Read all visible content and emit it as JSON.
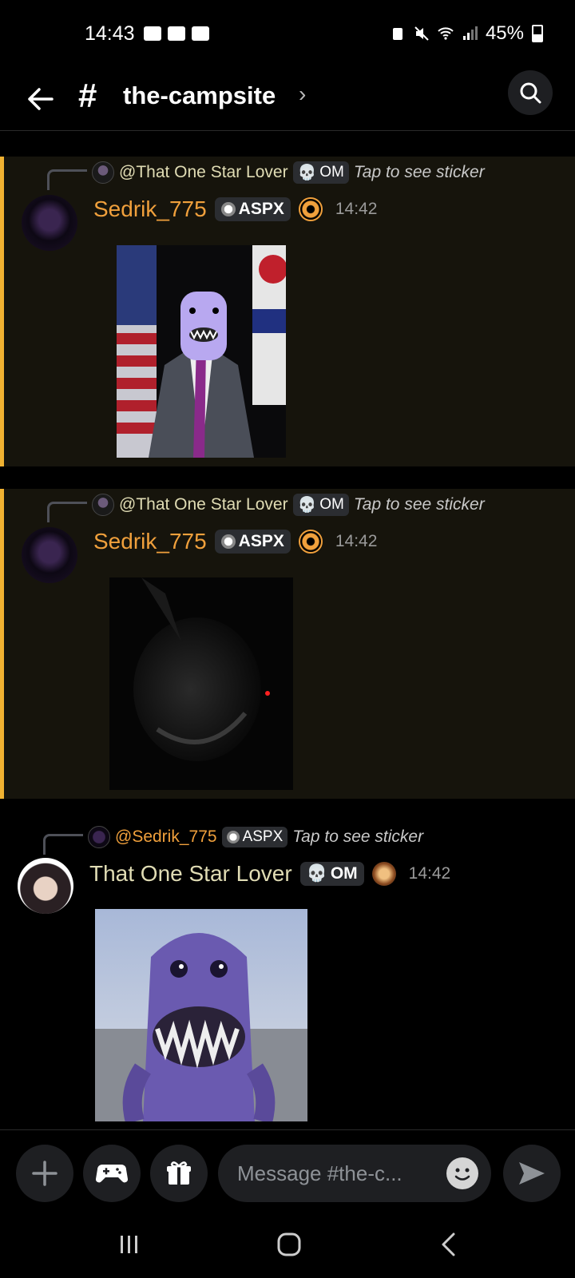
{
  "status": {
    "time": "14:43",
    "battery": "45%"
  },
  "header": {
    "channel": "the-campsite"
  },
  "messages": [
    {
      "reply_to": "@That One Star Lover",
      "reply_tag": "OM",
      "reply_text": "Tap to see sticker",
      "author": "Sedrik_775",
      "tag": "ASPX",
      "time": "14:42"
    },
    {
      "reply_to": "@That One Star Lover",
      "reply_tag": "OM",
      "reply_text": "Tap to see sticker",
      "author": "Sedrik_775",
      "tag": "ASPX",
      "time": "14:42"
    },
    {
      "reply_to": "@Sedrik_775",
      "reply_tag": "ASPX",
      "reply_text": "Tap to see sticker",
      "author": "That One Star Lover",
      "tag": "OM",
      "time": "14:42"
    }
  ],
  "composer": {
    "placeholder": "Message #the-c..."
  },
  "colors": {
    "mention_bar": "#f0b232",
    "mention_bg": "#16140c",
    "sedrik_name": "#f0a03c",
    "star_lover_name": "#e0dcb4"
  }
}
